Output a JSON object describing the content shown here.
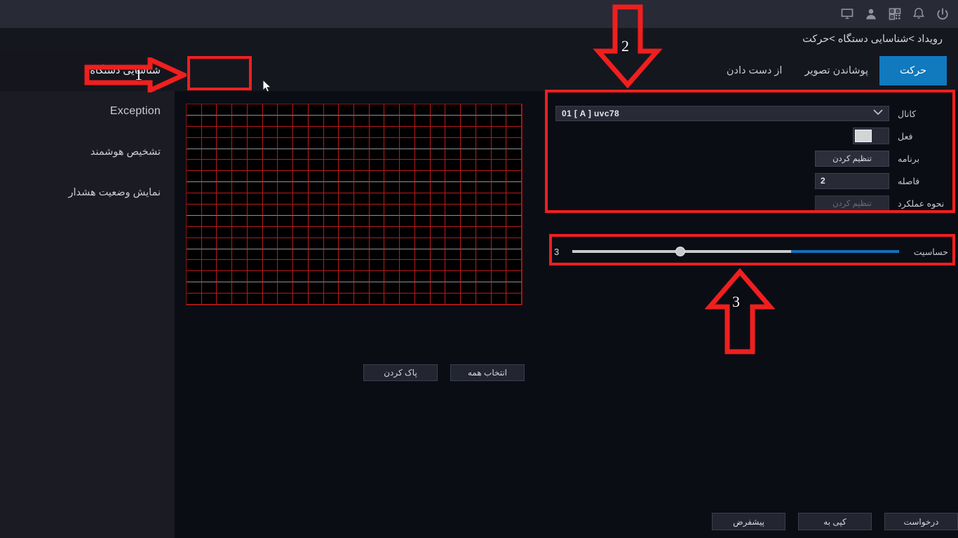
{
  "topbar": {
    "icons": [
      {
        "name": "monitor-icon",
        "label": "Monitor"
      },
      {
        "name": "user-icon",
        "label": "User"
      },
      {
        "name": "qrcode-icon",
        "label": "QR Code"
      },
      {
        "name": "bell-icon",
        "label": "Alarm"
      },
      {
        "name": "power-icon",
        "label": "Power"
      }
    ]
  },
  "breadcrumb": {
    "text": "رویداد >شناسایی دستگاه >حرکت"
  },
  "sidebar": {
    "items": [
      {
        "label": "شناسایی دستگاه",
        "active": true,
        "latin": false
      },
      {
        "label": "Exception",
        "active": false,
        "latin": true
      },
      {
        "label": "تشخیص هوشمند",
        "active": false,
        "latin": false
      },
      {
        "label": "نمایش وضعیت هشدار",
        "active": false,
        "latin": false
      }
    ]
  },
  "tabs": [
    {
      "label": "حرکت",
      "active": true
    },
    {
      "label": "پوشاندن تصویر",
      "active": false
    },
    {
      "label": "از دست دادن",
      "active": false
    }
  ],
  "grid": {
    "columns": 22,
    "rows": 18,
    "select_all_label": "انتخاب همه",
    "clear_label": "پاک کردن"
  },
  "form": {
    "channel": {
      "label": "کانال",
      "value": "01 [ A ] uvc78",
      "chevron": "⌄"
    },
    "enable": {
      "label": "فعل",
      "on": false
    },
    "schedule": {
      "label": "برنامه",
      "button": "تنظیم کردن"
    },
    "interval": {
      "label": "فاصله",
      "value": "2"
    },
    "action": {
      "label": "نحوه عملکرد",
      "button": "تنظیم کردن",
      "disabled": true
    },
    "sensitivity": {
      "label": "حساسیت",
      "value": "3",
      "percent": 33,
      "min": 0,
      "max": 9
    }
  },
  "footer": {
    "buttons": [
      {
        "label": "پیشفرض",
        "name": "default-button"
      },
      {
        "label": "کپی به",
        "name": "copy-to-button"
      },
      {
        "label": "درخواست",
        "name": "apply-button"
      }
    ]
  },
  "annotations": [
    {
      "number": "1",
      "direction": "right"
    },
    {
      "number": "2",
      "direction": "down"
    },
    {
      "number": "3",
      "direction": "up"
    }
  ],
  "colors": {
    "accent": "#1179bd",
    "annotation": "#f01f1f",
    "grid_line": "#b81b1b",
    "topbar_bg": "#282a36",
    "sidebar_bg": "#1a1b23",
    "content_bg": "#0b0d15"
  }
}
